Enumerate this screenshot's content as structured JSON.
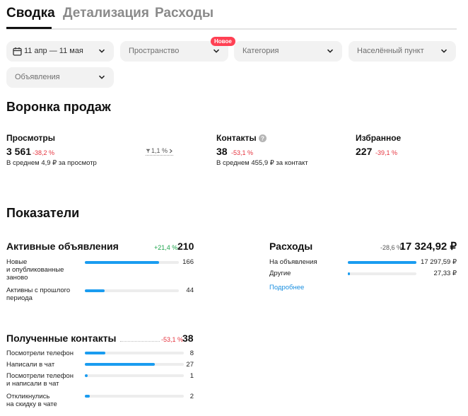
{
  "tabs": [
    {
      "label": "Сводка"
    },
    {
      "label": "Детализация"
    },
    {
      "label": "Расходы"
    }
  ],
  "filters": {
    "date": "11 апр — 11 мая",
    "space": "Пространство",
    "space_badge": "Новое",
    "category": "Категория",
    "city": "Населённый пункт",
    "ads": "Объявления"
  },
  "funnel": {
    "title": "Воронка продаж",
    "views": {
      "name": "Просмотры",
      "value": "3 561",
      "delta": "-38,2 %",
      "sub": "В среднем 4,9 ₽ за просмотр"
    },
    "conversion": "1,1 %",
    "contacts": {
      "name": "Контакты",
      "value": "38",
      "delta": "-53,1 %",
      "sub": "В среднем 455,9 ₽ за контакт"
    },
    "favorites": {
      "name": "Избранное",
      "value": "227",
      "delta": "-39,1 %"
    }
  },
  "indicators": {
    "title": "Показатели",
    "active_ads": {
      "title": "Активные объявления",
      "delta": "+21,4 %",
      "value": "210",
      "rows": [
        {
          "label": "Новые\nи опубликованные\nзаново",
          "value": "166",
          "fraction": 0.79
        },
        {
          "label": "Активны с прошлого\nпериода",
          "value": "44",
          "fraction": 0.21
        }
      ]
    },
    "expenses": {
      "title": "Расходы",
      "delta": "-28,6 %",
      "value": "17 324,92 ₽",
      "rows": [
        {
          "label": "На объявления",
          "value": "17 297,59 ₽",
          "fraction": 0.998
        },
        {
          "label": "Другие",
          "value": "27,33 ₽",
          "fraction": 0.02
        }
      ],
      "more_link": "Подробнее"
    },
    "contacts": {
      "title": "Полученные контакты",
      "delta": "-53,1 %",
      "value": "38",
      "rows": [
        {
          "label": "Посмотрели телефон",
          "value": "8",
          "fraction": 0.21
        },
        {
          "label": "Написали в чат",
          "value": "27",
          "fraction": 0.71
        },
        {
          "label": "Посмотрели телефон\nи написали в чат",
          "value": "1",
          "fraction": 0.03
        },
        {
          "label": "Откликнулись\nна скидку в чате",
          "value": "2",
          "fraction": 0.05
        }
      ]
    }
  },
  "colors": {
    "accent": "#1a9cf0",
    "negative": "#e5343f",
    "positive": "#1aa34a",
    "badge": "#ff4053"
  }
}
